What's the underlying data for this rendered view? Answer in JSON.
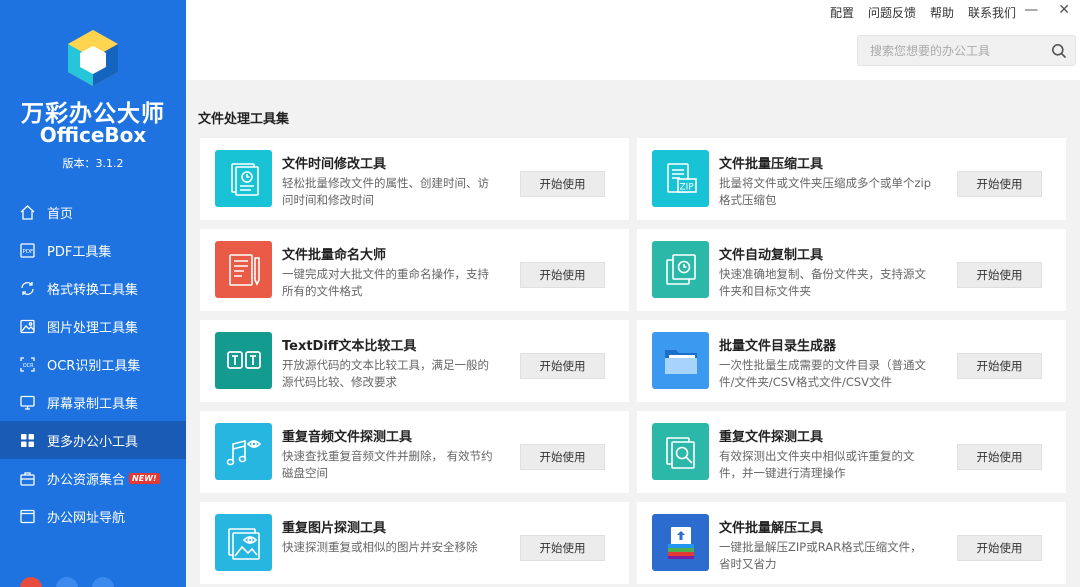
{
  "app": {
    "title": "万彩办公大师",
    "subtitle": "OfficeBox",
    "version": "版本：3.1.2"
  },
  "nav": [
    {
      "label": "首页",
      "icon": "home-icon",
      "active": false
    },
    {
      "label": "PDF工具集",
      "icon": "pdf-icon",
      "active": false
    },
    {
      "label": "格式转换工具集",
      "icon": "convert-icon",
      "active": false
    },
    {
      "label": "图片处理工具集",
      "icon": "image-icon",
      "active": false
    },
    {
      "label": "OCR识别工具集",
      "icon": "ocr-icon",
      "active": false
    },
    {
      "label": "屏幕录制工具集",
      "icon": "monitor-icon",
      "active": false
    },
    {
      "label": "更多办公小工具",
      "icon": "grid-icon",
      "active": true
    },
    {
      "label": "办公资源集合",
      "icon": "briefcase-icon",
      "active": false,
      "badge": "NEW!"
    },
    {
      "label": "办公网址导航",
      "icon": "browser-icon",
      "active": false
    }
  ],
  "top_links": [
    "配置",
    "问题反馈",
    "帮助",
    "联系我们"
  ],
  "search": {
    "placeholder": "搜索您想要的办公工具"
  },
  "section_title": "文件处理工具集",
  "button_label": "开始使用",
  "cards": [
    {
      "title": "文件时间修改工具",
      "desc": "轻松批量修改文件的属性、创建时间、访问时间和修改时间",
      "color": "#18c3d6",
      "icon": "file-clock-icon"
    },
    {
      "title": "文件批量压缩工具",
      "desc": "批量将文件或文件夹压缩成多个或单个zip格式压缩包",
      "color": "#18c3d6",
      "icon": "zip-file-icon"
    },
    {
      "title": "文件批量命名大师",
      "desc": "一键完成对大批文件的重命名操作，支持所有的文件格式",
      "color": "#ea5b47",
      "icon": "file-pen-icon"
    },
    {
      "title": "文件自动复制工具",
      "desc": "快速准确地复制、备份文件夹，支持源文件夹和目标文件夹",
      "color": "#2cb8a9",
      "icon": "copy-clock-icon"
    },
    {
      "title": "TextDiff文本比较工具",
      "desc": "开放源代码的文本比较工具，满足一般的源代码比较、修改要求",
      "color": "#129b8e",
      "icon": "text-compare-icon"
    },
    {
      "title": "批量文件目录生成器",
      "desc": "一次性批量生成需要的文件目录（普通文件/文件夹/CSV格式文件/CSV文件",
      "color": "#3b9af0",
      "icon": "folder-icon"
    },
    {
      "title": "重复音频文件探测工具",
      "desc": "快速查找重复音频文件并删除， 有效节约磁盘空间",
      "color": "#27b6e0",
      "icon": "music-eye-icon"
    },
    {
      "title": "重复文件探测工具",
      "desc": "有效探测出文件夹中相似或许重复的文件，并一键进行清理操作",
      "color": "#2cb8a9",
      "icon": "file-search-icon"
    },
    {
      "title": "重复图片探测工具",
      "desc": "快速探测重复或相似的图片并安全移除",
      "color": "#27b6e0",
      "icon": "image-eye-icon"
    },
    {
      "title": "文件批量解压工具",
      "desc": "一键批量解压ZIP或RAR格式压缩文件，省时又省力",
      "color": "#2d6ccf",
      "icon": "archive-icon"
    }
  ]
}
